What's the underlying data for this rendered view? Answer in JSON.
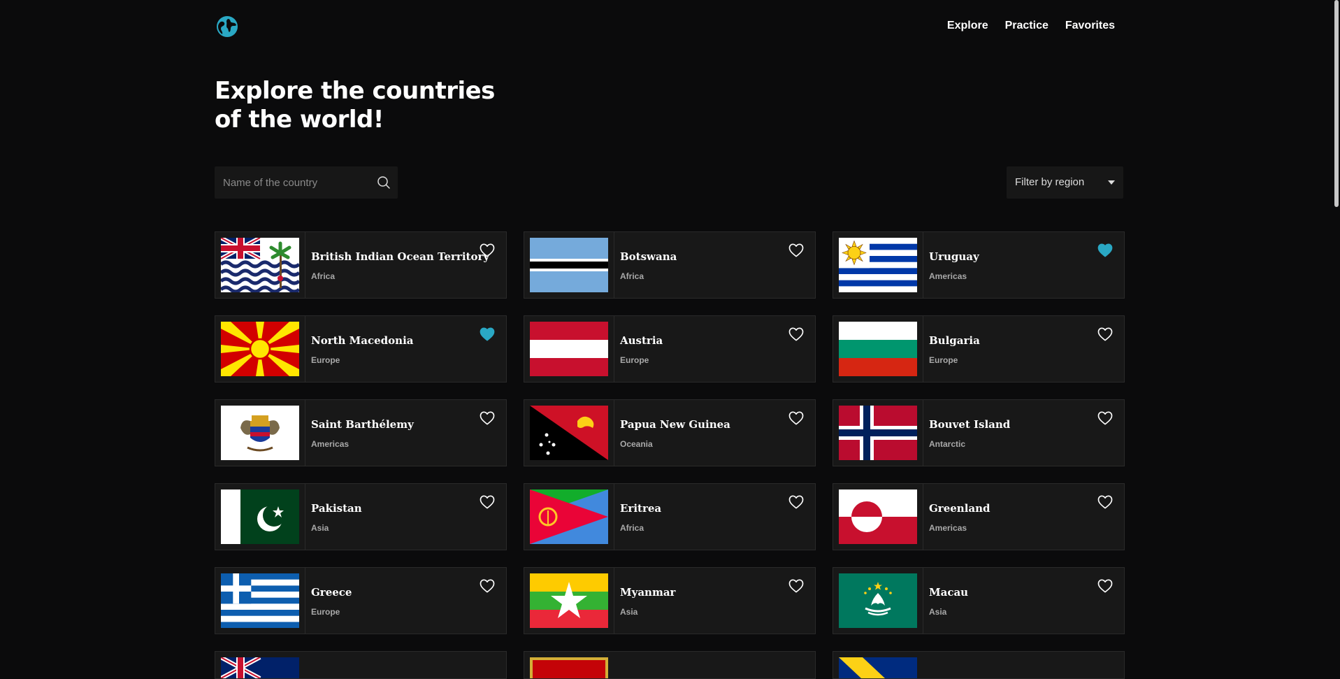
{
  "nav": {
    "explore": "Explore",
    "practice": "Practice",
    "favorites": "Favorites"
  },
  "hero": {
    "line1": "Explore the countries",
    "line2": "of the world!"
  },
  "search": {
    "placeholder": "Name of the country",
    "value": ""
  },
  "filter": {
    "label": "Filter by region"
  },
  "colors": {
    "accent": "#2aa8c4",
    "background": "#0b0b0c",
    "card": "#181818"
  },
  "countries": [
    {
      "name": "British Indian Ocean Territory",
      "region": "Africa",
      "favorite": false,
      "flag": "british-indian-ocean-territory-flag"
    },
    {
      "name": "Botswana",
      "region": "Africa",
      "favorite": false,
      "flag": "botswana-flag"
    },
    {
      "name": "Uruguay",
      "region": "Americas",
      "favorite": true,
      "flag": "uruguay-flag"
    },
    {
      "name": "North Macedonia",
      "region": "Europe",
      "favorite": true,
      "flag": "north-macedonia-flag"
    },
    {
      "name": "Austria",
      "region": "Europe",
      "favorite": false,
      "flag": "austria-flag"
    },
    {
      "name": "Bulgaria",
      "region": "Europe",
      "favorite": false,
      "flag": "bulgaria-flag"
    },
    {
      "name": "Saint Barthélemy",
      "region": "Americas",
      "favorite": false,
      "flag": "saint-barthelemy-flag"
    },
    {
      "name": "Papua New Guinea",
      "region": "Oceania",
      "favorite": false,
      "flag": "papua-new-guinea-flag"
    },
    {
      "name": "Bouvet Island",
      "region": "Antarctic",
      "favorite": false,
      "flag": "bouvet-island-flag"
    },
    {
      "name": "Pakistan",
      "region": "Asia",
      "favorite": false,
      "flag": "pakistan-flag"
    },
    {
      "name": "Eritrea",
      "region": "Africa",
      "favorite": false,
      "flag": "eritrea-flag"
    },
    {
      "name": "Greenland",
      "region": "Americas",
      "favorite": false,
      "flag": "greenland-flag"
    },
    {
      "name": "Greece",
      "region": "Europe",
      "favorite": false,
      "flag": "greece-flag"
    },
    {
      "name": "Myanmar",
      "region": "Asia",
      "favorite": false,
      "flag": "myanmar-flag"
    },
    {
      "name": "Macau",
      "region": "Asia",
      "favorite": false,
      "flag": "macau-flag"
    }
  ]
}
